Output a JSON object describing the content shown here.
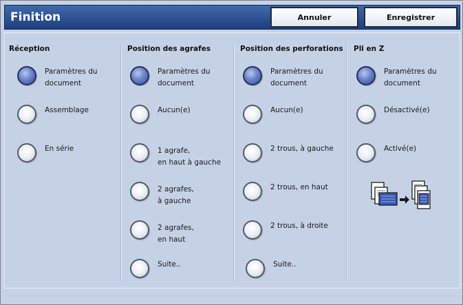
{
  "header": {
    "title": "Finition",
    "cancel_label": "Annuler",
    "save_label": "Enregistrer"
  },
  "columns": [
    {
      "heading": "Réception",
      "options": [
        {
          "label": "Paramètres du\ndocument",
          "selected": true
        },
        {
          "label": "Assemblage",
          "selected": false
        },
        {
          "label": "En série",
          "selected": false
        }
      ]
    },
    {
      "heading": "Position des agrafes",
      "options": [
        {
          "label": "Paramètres du\ndocument",
          "selected": true
        },
        {
          "label": "Aucun(e)",
          "selected": false
        },
        {
          "label": "1 agrafe,\nen haut à gauche",
          "selected": false
        },
        {
          "label": "2 agrafes,\nà gauche",
          "selected": false
        },
        {
          "label": "2 agrafes,\nen haut",
          "selected": false
        },
        {
          "label": "Suite..",
          "selected": false
        }
      ]
    },
    {
      "heading": "Position des perforations",
      "options": [
        {
          "label": "Paramètres du\ndocument",
          "selected": true
        },
        {
          "label": "Aucun(e)",
          "selected": false
        },
        {
          "label": "2 trous, à gauche",
          "selected": false
        },
        {
          "label": "2 trous, en haut",
          "selected": false
        },
        {
          "label": "2 trous, à droite",
          "selected": false
        },
        {
          "label": "Suite..",
          "selected": false
        }
      ]
    },
    {
      "heading": "Pli en Z",
      "options": [
        {
          "label": "Paramètres du\ndocument",
          "selected": true
        },
        {
          "label": "Désactivé(e)",
          "selected": false
        },
        {
          "label": "Activé(e)",
          "selected": false
        }
      ]
    }
  ],
  "zfold_icon": "z-fold-illustration-icon",
  "colors": {
    "titlebar": "#1e3f7d",
    "panel": "#c5d2e6",
    "radio_selected": "#4a63b0"
  }
}
